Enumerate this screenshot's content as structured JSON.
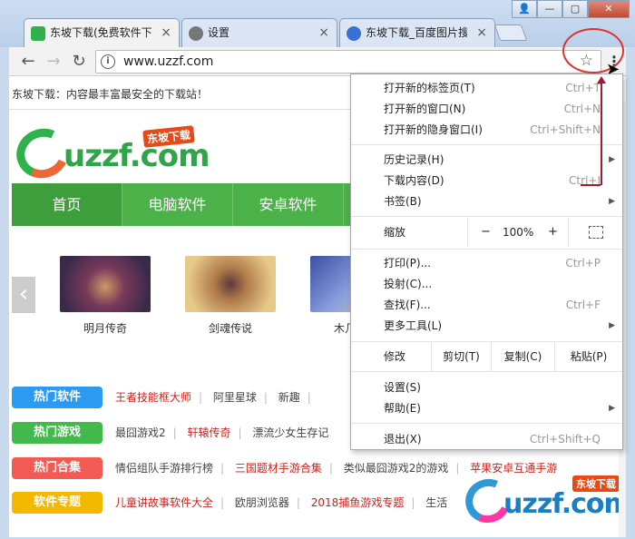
{
  "window": {
    "controls": {
      "user": "👤",
      "minimize": "—",
      "maximize": "▢",
      "close": "✕"
    }
  },
  "tabs": [
    {
      "title": "东坡下载(免费软件下",
      "favicon_color": "#2fb24b",
      "close": "×"
    },
    {
      "title": "设置",
      "favicon_color": "#777",
      "close": "×"
    },
    {
      "title": "东坡下载_百度图片搜",
      "favicon_color": "#3a6fd8",
      "close": "×"
    }
  ],
  "toolbar": {
    "back": "←",
    "forward": "→",
    "reload": "↻",
    "info_icon": "i",
    "url": "www.uzzf.com",
    "star": "☆",
    "menu_dots": "⋮"
  },
  "page": {
    "tagline": "东坡下载：内容最丰富最安全的下载站！",
    "logo": {
      "word": "uzzf.com",
      "badge": "东坡下载"
    },
    "nav": [
      "首页",
      "电脑软件",
      "安卓软件"
    ],
    "slider_arrow": "‹",
    "games": [
      {
        "name": "明月传奇",
        "colors": [
          "#3a2a4a",
          "#c96"
        ]
      },
      {
        "name": "剑魂传说",
        "colors": [
          "#d8b26a",
          "#5a3a3a"
        ]
      },
      {
        "name": "木几",
        "colors": [
          "#6a7fc0",
          "#e3d07a"
        ]
      }
    ],
    "categories": [
      {
        "badge": "热门软件",
        "color": "#2c9af1",
        "links": [
          {
            "text": "王者技能框大师",
            "red": true
          },
          {
            "text": "阿里星球",
            "red": false
          },
          {
            "text": "新趣",
            "red": false
          }
        ]
      },
      {
        "badge": "热门游戏",
        "color": "#43b94b",
        "links": [
          {
            "text": "最囧游戏2",
            "red": false
          },
          {
            "text": "轩辕传奇",
            "red": true
          },
          {
            "text": "漂流少女生存记",
            "red": false
          }
        ]
      },
      {
        "badge": "热门合集",
        "color": "#f25b54",
        "links": [
          {
            "text": "情侣组队手游排行榜",
            "red": false
          },
          {
            "text": "三国题材手游合集",
            "red": true
          },
          {
            "text": "类似最囧游戏2的游戏",
            "red": false
          },
          {
            "text": "苹果安卓互通手游",
            "red": true
          }
        ]
      },
      {
        "badge": "软件专题",
        "color": "#f5b800",
        "links": [
          {
            "text": "儿童讲故事软件大全",
            "red": true
          },
          {
            "text": "欧朋浏览器",
            "red": false
          },
          {
            "text": "2018捕鱼游戏专题",
            "red": true
          },
          {
            "text": "生活",
            "red": false
          }
        ]
      }
    ],
    "watermark": {
      "word": "uzzf.com",
      "badge": "东坡下载"
    }
  },
  "menu": {
    "items_top": [
      {
        "label": "打开新的标签页(T)",
        "shortcut": "Ctrl+T"
      },
      {
        "label": "打开新的窗口(N)",
        "shortcut": "Ctrl+N"
      },
      {
        "label": "打开新的隐身窗口(I)",
        "shortcut": "Ctrl+Shift+N"
      }
    ],
    "items_mid": [
      {
        "label": "历史记录(H)",
        "shortcut": "",
        "arrow": "▶"
      },
      {
        "label": "下载内容(D)",
        "shortcut": "Ctrl+J",
        "arrow": ""
      },
      {
        "label": "书签(B)",
        "shortcut": "",
        "arrow": "▶"
      }
    ],
    "zoom": {
      "label": "缩放",
      "minus": "−",
      "value": "100%",
      "plus": "+"
    },
    "items_tools": [
      {
        "label": "打印(P)...",
        "shortcut": "Ctrl+P",
        "arrow": ""
      },
      {
        "label": "投射(C)...",
        "shortcut": "",
        "arrow": ""
      },
      {
        "label": "查找(F)...",
        "shortcut": "Ctrl+F",
        "arrow": ""
      },
      {
        "label": "更多工具(L)",
        "shortcut": "",
        "arrow": "▶"
      }
    ],
    "edit": {
      "label": "修改",
      "cut": "剪切(T)",
      "copy": "复制(C)",
      "paste": "粘贴(P)"
    },
    "items_bottom": [
      {
        "label": "设置(S)",
        "shortcut": "",
        "arrow": ""
      },
      {
        "label": "帮助(E)",
        "shortcut": "",
        "arrow": "▶"
      }
    ],
    "exit": {
      "label": "退出(X)",
      "shortcut": "Ctrl+Shift+Q"
    }
  }
}
